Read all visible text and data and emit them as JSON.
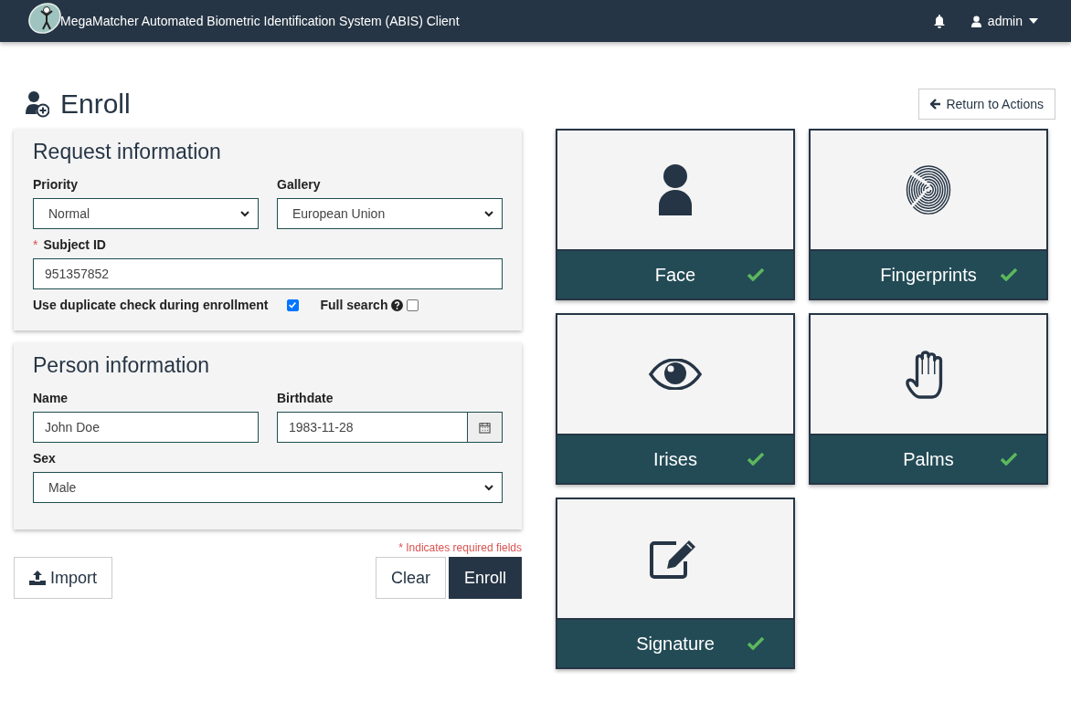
{
  "header": {
    "title": "MegaMatcher Automated Biometric Identification System (ABIS) Client",
    "user": "admin"
  },
  "page": {
    "title": "Enroll",
    "back_button": "Return to Actions"
  },
  "panels": [
    {
      "title": "Request information",
      "rows": [
        [
          {
            "kind": "select",
            "label": "Priority",
            "value": "Normal"
          },
          {
            "kind": "select",
            "label": "Gallery",
            "value": "European Union"
          }
        ],
        [
          {
            "kind": "text",
            "label": "Subject ID",
            "required_mark": "*",
            "value": "951357852"
          }
        ]
      ],
      "checks": [
        {
          "label": "Use duplicate check during enrollment",
          "checked": true,
          "help": false
        },
        {
          "label": "Full search",
          "checked": false,
          "help": true
        }
      ]
    },
    {
      "title": "Person information",
      "rows": [
        [
          {
            "kind": "text",
            "label": "Name",
            "value": "John Doe"
          },
          {
            "kind": "date",
            "label": "Birthdate",
            "value": "1983-11-28"
          }
        ],
        [
          {
            "kind": "select",
            "label": "Sex",
            "value": "Male"
          }
        ]
      ]
    }
  ],
  "required_note": "* Indicates required fields",
  "import_button": "Import",
  "clear_button": "Clear",
  "enroll_button": "Enroll",
  "modalities": [
    {
      "label": "Face",
      "kind": "face",
      "done": true
    },
    {
      "label": "Fingerprints",
      "kind": "fingerprint",
      "done": true
    },
    {
      "label": "Irises",
      "kind": "iris",
      "done": true
    },
    {
      "label": "Palms",
      "kind": "palm",
      "done": true
    },
    {
      "label": "Signature",
      "kind": "signature",
      "done": true
    }
  ]
}
